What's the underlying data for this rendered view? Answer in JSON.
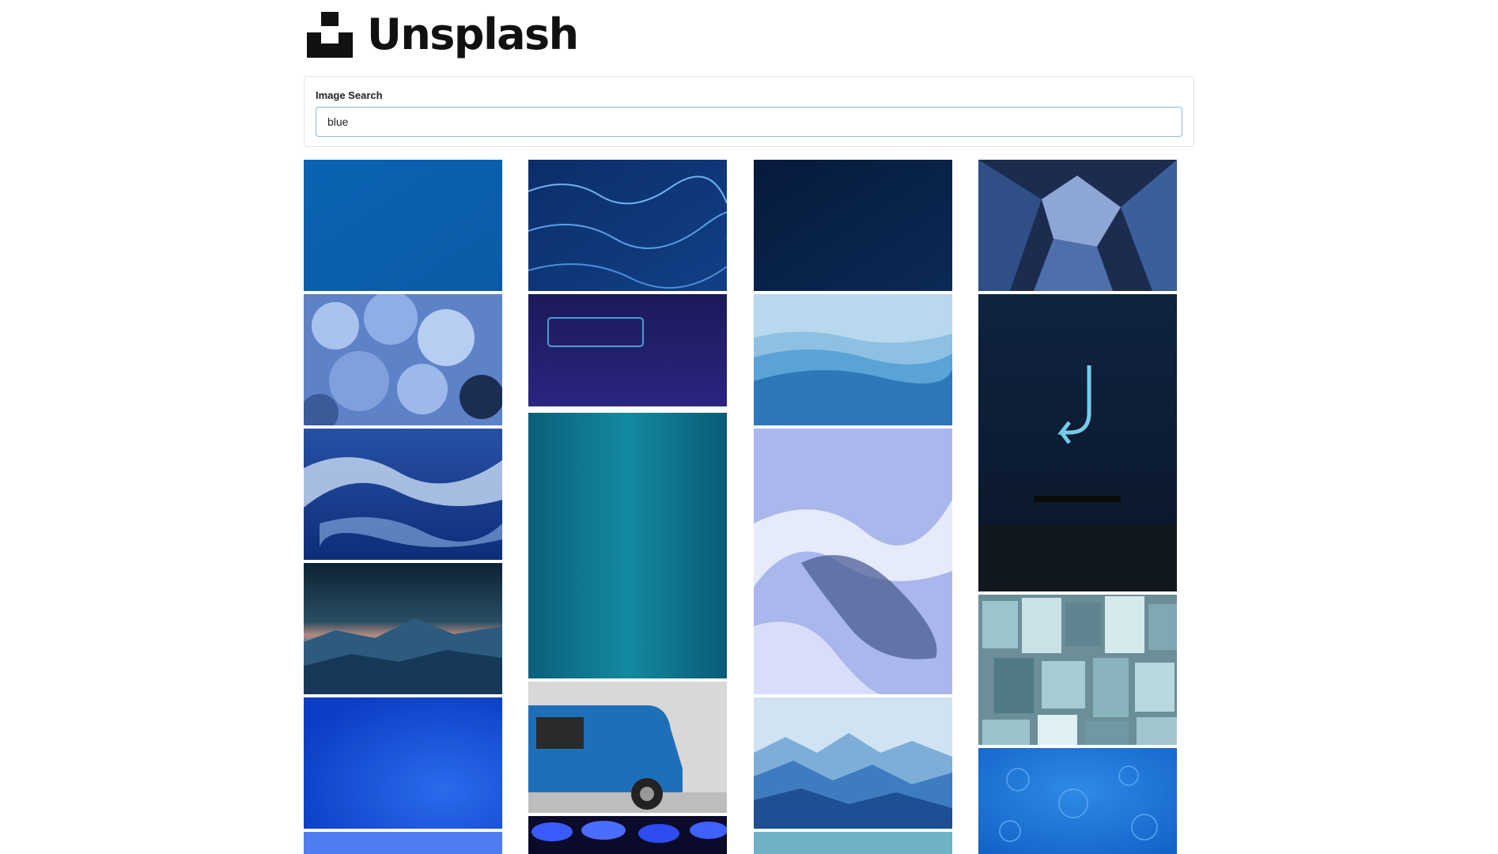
{
  "brand": {
    "name": "Unsplash"
  },
  "search": {
    "label": "Image Search",
    "value": "blue",
    "placeholder": ""
  },
  "colors": {
    "border": "#e1e1e1",
    "focus": "#8db8dc",
    "text": "#111111"
  }
}
